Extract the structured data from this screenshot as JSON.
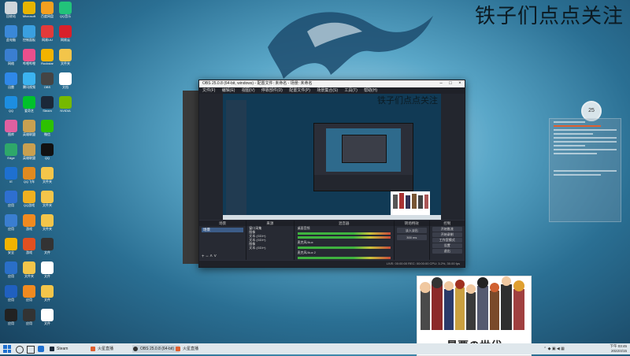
{
  "wallpaper": {
    "overlay_text": "铁子们点点关注"
  },
  "desktop_icons": [
    {
      "label": "回收站",
      "color": "#cfd6db"
    },
    {
      "label": "Microsoft",
      "color": "#e7b400"
    },
    {
      "label": "百度网盘",
      "color": "#f4a020"
    },
    {
      "label": "QQ音乐",
      "color": "#22c37a"
    },
    {
      "label": "此电脑",
      "color": "#3a88d8"
    },
    {
      "label": "控制面板",
      "color": "#3aa0e0"
    },
    {
      "label": "网易UU",
      "color": "#e23a3a"
    },
    {
      "label": "网易云",
      "color": "#d8202a"
    },
    {
      "label": "网络",
      "color": "#3a7ed0"
    },
    {
      "label": "哔哩哔哩",
      "color": "#e94f8c"
    },
    {
      "label": "Rockstar",
      "color": "#f2b300"
    },
    {
      "label": "文件夹",
      "color": "#f3c54a"
    },
    {
      "label": "迅雷",
      "color": "#2f88e8"
    },
    {
      "label": "腾讯视频",
      "color": "#3bb3f0"
    },
    {
      "label": "OBS",
      "color": "#444"
    },
    {
      "label": "文档",
      "color": "#ffffff"
    },
    {
      "label": "QQ",
      "color": "#1d8ee0"
    },
    {
      "label": "爱奇艺",
      "color": "#00c12b"
    },
    {
      "label": "Steam",
      "color": "#1b2838"
    },
    {
      "label": "NVIDIA",
      "color": "#76b900"
    },
    {
      "label": "图库",
      "color": "#e060a0"
    },
    {
      "label": "英雄联盟",
      "color": "#c9a050"
    },
    {
      "label": "微信",
      "color": "#2dc100"
    },
    {
      "label": "",
      "color": "transparent"
    },
    {
      "label": "Edge",
      "color": "#2ea86a"
    },
    {
      "label": "英雄联盟",
      "color": "#c9a050"
    },
    {
      "label": "QQ",
      "color": "#111"
    },
    {
      "label": "",
      "color": "transparent"
    },
    {
      "label": "IE",
      "color": "#1e70d0"
    },
    {
      "label": "QQ飞车",
      "color": "#e08a20"
    },
    {
      "label": "文件夹",
      "color": "#f3c54a"
    },
    {
      "label": "",
      "color": "transparent"
    },
    {
      "label": "应用",
      "color": "#2e6fd0"
    },
    {
      "label": "QQ游戏",
      "color": "#f0b020"
    },
    {
      "label": "文件夹",
      "color": "#f3c54a"
    },
    {
      "label": "",
      "color": "transparent"
    },
    {
      "label": "应用",
      "color": "#3a7ed0"
    },
    {
      "label": "游戏",
      "color": "#f08a20"
    },
    {
      "label": "文件夹",
      "color": "#f3c54a"
    },
    {
      "label": "",
      "color": "transparent"
    },
    {
      "label": "安全",
      "color": "#f2b300"
    },
    {
      "label": "游戏",
      "color": "#e05020"
    },
    {
      "label": "文件",
      "color": "#333"
    },
    {
      "label": "",
      "color": "transparent"
    },
    {
      "label": "应用",
      "color": "#2a6fc8"
    },
    {
      "label": "文件夹",
      "color": "#f3c54a"
    },
    {
      "label": "文件",
      "color": "#ffffff"
    },
    {
      "label": "",
      "color": "transparent"
    },
    {
      "label": "应用",
      "color": "#2060c0"
    },
    {
      "label": "应用",
      "color": "#f08a20"
    },
    {
      "label": "文件",
      "color": "#f3c54a"
    },
    {
      "label": "",
      "color": "transparent"
    },
    {
      "label": "应用",
      "color": "#222"
    },
    {
      "label": "应用",
      "color": "#333"
    },
    {
      "label": "文件",
      "color": "#ffffff"
    }
  ],
  "obs": {
    "title": "OBS 25.0.8 (64-bit, windows) - 配置文件: 未命名 - 场景: 未命名",
    "menu": [
      "文件(F)",
      "编辑(E)",
      "视图(V)",
      "停靠部件(D)",
      "配置文件(P)",
      "场景集合(S)",
      "工具(T)",
      "帮助(H)"
    ],
    "docks": [
      "场景",
      "来源",
      "混音器",
      "转场特效",
      "控制"
    ],
    "scene_item": "场景",
    "sources": [
      "窗口采集",
      "图像",
      "文本 (GDI+)",
      "文本 (GDI+)",
      "图像",
      "文本 (GDI+)"
    ],
    "mixer": [
      "桌面音频",
      "麦克风/Aux",
      "麦克风/Aux 2"
    ],
    "transition": "淡入淡出",
    "duration": "300 ms",
    "controls": [
      "开始推流",
      "开始录制",
      "工作室模式",
      "设置",
      "退出"
    ],
    "status": "LIVE: 00:00:00  REC: 00:00:00  CPU: 3.2%, 30.00 fps"
  },
  "widget": {
    "temp": "25"
  },
  "anime_caption": "最悪の世代",
  "taskbar": {
    "items": [
      "Steam",
      "火星直播",
      "OBS 25.0.8 (64-bit)",
      "火星直播"
    ],
    "time": "下午 03:45",
    "date": "2022/4/15"
  }
}
